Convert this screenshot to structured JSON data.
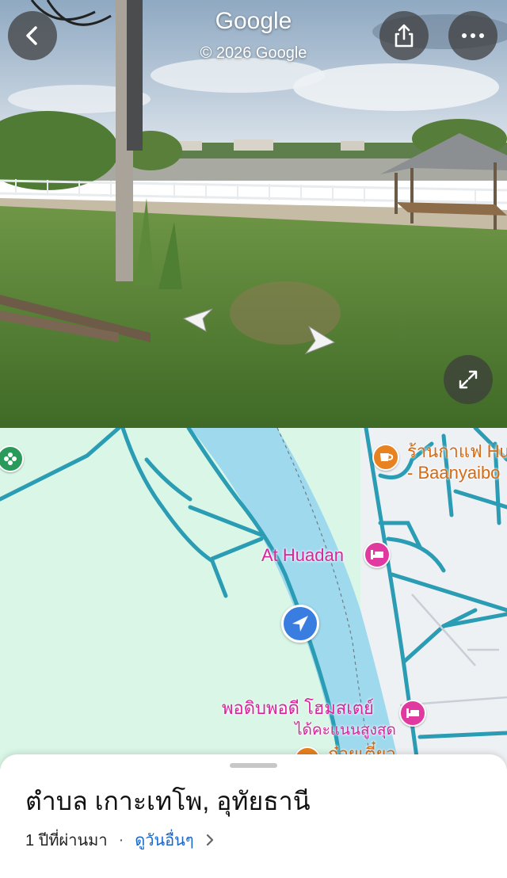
{
  "street_view": {
    "title": "Google",
    "copyright": "© 2026 Google",
    "back_icon": "chevron-left-icon",
    "share_icon": "share-icon",
    "more_icon": "more-horizontal-icon",
    "expand_icon": "expand-icon"
  },
  "map": {
    "pois": [
      {
        "label": "ร้านกาแฟ Hu",
        "sub": "- Baanyaibo",
        "icon": "coffee-icon",
        "color": "#e8811f"
      },
      {
        "label": "At Huadan",
        "icon": "hotel-icon",
        "color": "#e0399f"
      },
      {
        "label": "พอดิบพอดี โฮมสเตย์",
        "sub": "ได้คะแนนสูงสุด",
        "icon": "hotel-icon",
        "color": "#e0399f"
      },
      {
        "label": "ก๋วยเตี๋ยว",
        "icon": "restaurant-icon",
        "color": "#e8811f"
      }
    ],
    "green_pin_icon": "flower-icon",
    "location_icon": "navigation-arrow-icon"
  },
  "sheet": {
    "title": "ตำบล เกาะเทโพ, อุทัยธานี",
    "time_ago": "1 ปีที่ผ่านมา",
    "separator": "·",
    "see_more": "ดูวันอื่นๆ",
    "see_more_icon": "chevron-right-icon"
  }
}
